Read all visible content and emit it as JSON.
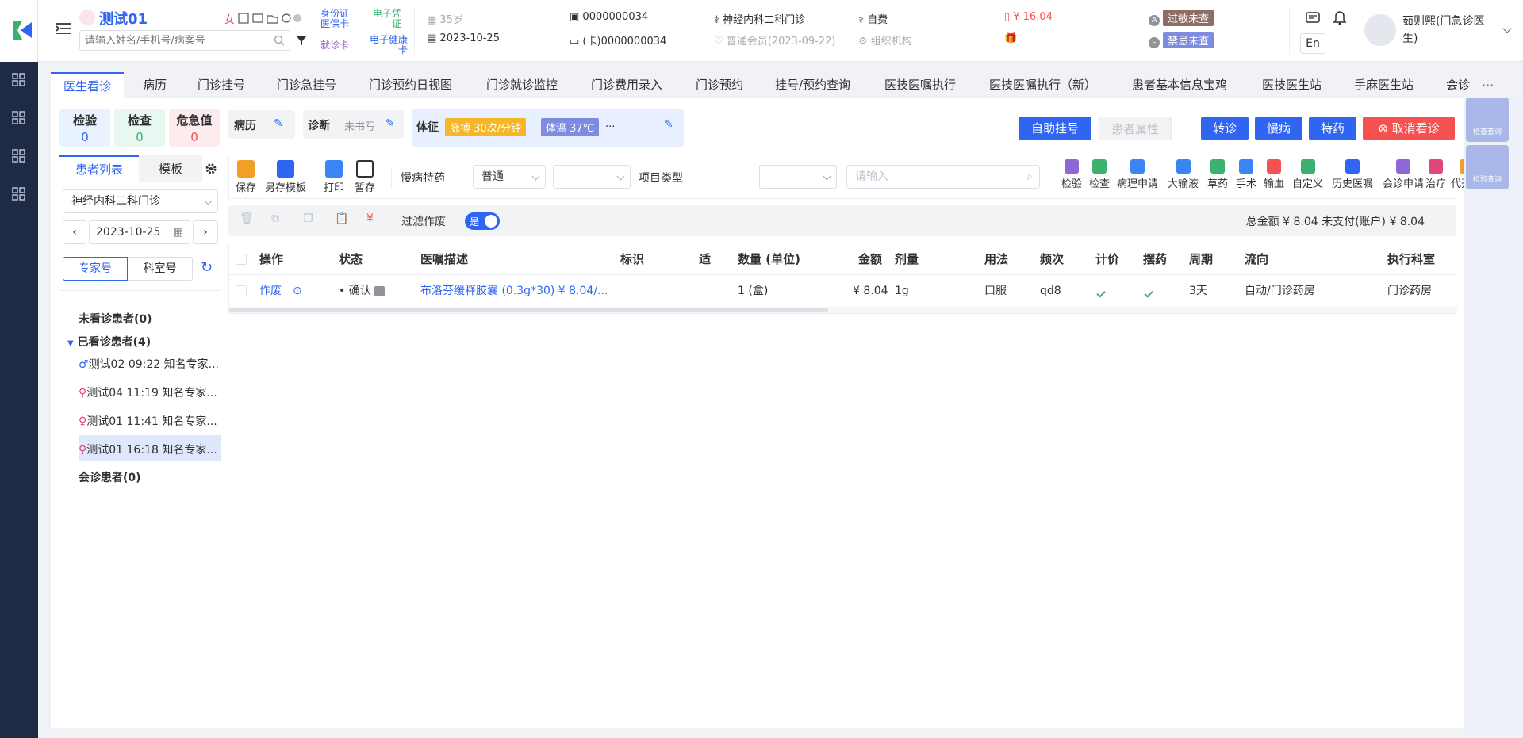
{
  "colors": {
    "primary": "#2f65f0",
    "danger": "#f55151",
    "warning": "#f6b625",
    "sidebar": "#1f2a44",
    "success": "#3bb16f"
  },
  "patient": {
    "name": "测试01",
    "gender": "女",
    "id_card": "身份证",
    "insurance": "医保卡",
    "e_voucher": "电子凭证",
    "visit_card": "就诊卡",
    "e_health": "电子健康卡",
    "search_placeholder": "请输入姓名/手机号/病案号"
  },
  "patient_info": {
    "age": "35岁",
    "date": "2023-10-25",
    "id": "0000000034",
    "card": "(卡)0000000034",
    "dept": "神经内科二科门诊",
    "member": "普通会员(2023-09-22)",
    "pay_type": "自费",
    "org": "组织机构",
    "balance": "¥ 16.04",
    "allergy": "过敏未查",
    "taboo": "禁忌未查"
  },
  "user": {
    "name": "茹则熙(门急诊医生)",
    "lang": "En"
  },
  "tabs": [
    "医生看诊",
    "病历",
    "门诊挂号",
    "门诊急挂号",
    "门诊预约日视图",
    "门诊就诊监控",
    "门诊费用录入",
    "门诊预约",
    "挂号/预约查询",
    "医技医嘱执行",
    "医技医嘱执行（新）",
    "患者基本信息宝鸡",
    "医技医生站",
    "手麻医生站",
    "会诊"
  ],
  "stats": [
    {
      "label": "检验",
      "value": "0"
    },
    {
      "label": "检查",
      "value": "0"
    },
    {
      "label": "危急值",
      "value": "0"
    }
  ],
  "record": {
    "history_label": "病历",
    "diag_label": "诊断",
    "diag_value": "未书写",
    "vitals_label": "体征",
    "pulse": "脉搏 30次/分钟",
    "temp": "体温 37℃",
    "more": "..."
  },
  "actions": {
    "self_register": "自助挂号",
    "patient_attr": "患者属性",
    "transfer": "转诊",
    "chronic": "慢病",
    "special": "特药",
    "cancel": "取消看诊"
  },
  "left_panel": {
    "tab_list": "患者列表",
    "tab_template": "模板",
    "dept": "神经内科二科门诊",
    "date": "2023-10-25",
    "expert": "专家号",
    "room": "科室号",
    "groups": {
      "not_seen": "未看诊患者(0)",
      "seen": "已看诊患者(4)",
      "consult": "会诊患者(0)"
    },
    "patients": [
      "测试02 09:22 知名专家...",
      "测试04 11:19 知名专家...",
      "测试01 11:41 知名专家...",
      "测试01 16:18 知名专家..."
    ]
  },
  "toolbar": {
    "save": "保存",
    "save_tpl": "另存模板",
    "print": "打印",
    "hold": "暂存",
    "chronic_label": "慢病特药",
    "chronic_value": "普通",
    "type_label": "项目类型",
    "search_placeholder": "请输入"
  },
  "right_tools": [
    "检验",
    "检查",
    "病理申请",
    "大输液",
    "草药",
    "手术",
    "输血",
    "自定义",
    "历史医嘱",
    "会诊申请",
    "治疗",
    "代开人"
  ],
  "filter": {
    "label": "过滤作废",
    "toggle": "是",
    "total": "总金额 ¥ 8.04 未支付(账户) ¥ 8.04"
  },
  "table": {
    "headers": [
      "操作",
      "状态",
      "医嘱描述",
      "标识",
      "适",
      "数量 (单位)",
      "金额",
      "剂量",
      "用法",
      "频次",
      "计价",
      "摆药",
      "周期",
      "流向",
      "执行科室"
    ],
    "row": {
      "op": "作废",
      "status": "确认",
      "desc": "布洛芬缓释胶囊 (0.3g*30)  ¥ 8.04/...",
      "qty": "1 (盒)",
      "amount": "¥ 8.04",
      "dose": "1g",
      "usage": "口服",
      "freq": "qd8",
      "cycle": "3天",
      "flow": "自动/门诊药房",
      "dept": "门诊药房"
    }
  },
  "right_rail": [
    "检查查询",
    "检验查询"
  ]
}
